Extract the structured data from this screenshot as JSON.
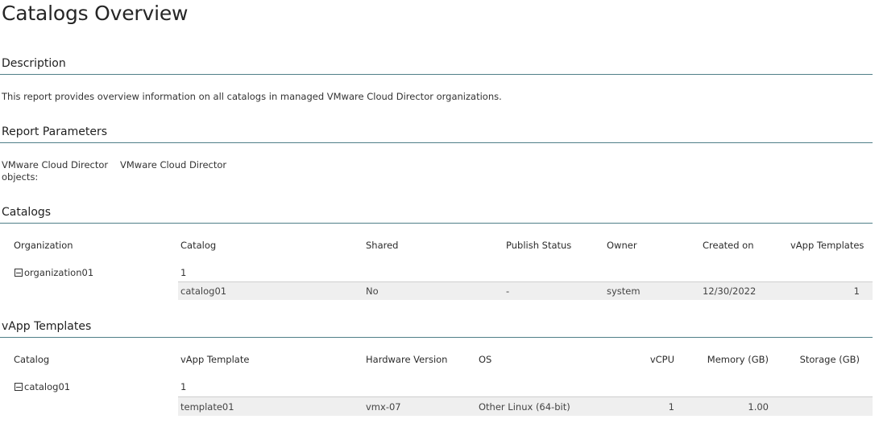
{
  "title": "Catalogs Overview",
  "description": {
    "heading": "Description",
    "text": "This report provides overview information on all catalogs in managed VMware Cloud Director organizations."
  },
  "parameters": {
    "heading": "Report Parameters",
    "label_line1": "VMware Cloud Director",
    "label_line2": "objects:",
    "value": "VMware Cloud Director"
  },
  "catalogs": {
    "heading": "Catalogs",
    "columns": [
      "Organization",
      "Catalog",
      "Shared",
      "Publish Status",
      "Owner",
      "Created on",
      "vApp Templates"
    ],
    "group": {
      "name": "organization01",
      "count": "1"
    },
    "rows": [
      {
        "catalog": "catalog01",
        "shared": "No",
        "publish_status": "-",
        "owner": "system",
        "created_on": "12/30/2022",
        "vapp_templates": "1"
      }
    ]
  },
  "vapp_templates": {
    "heading": "vApp Templates",
    "columns": [
      "Catalog",
      "vApp Template",
      "Hardware Version",
      "OS",
      "vCPU",
      "Memory (GB)",
      "Storage (GB)"
    ],
    "group": {
      "name": "catalog01",
      "count": "1"
    },
    "rows": [
      {
        "template": "template01",
        "hardware_version": "vmx-07",
        "os": "Other Linux (64-bit)",
        "vcpu": "1",
        "memory_gb": "1.00",
        "storage_gb": ""
      }
    ]
  }
}
